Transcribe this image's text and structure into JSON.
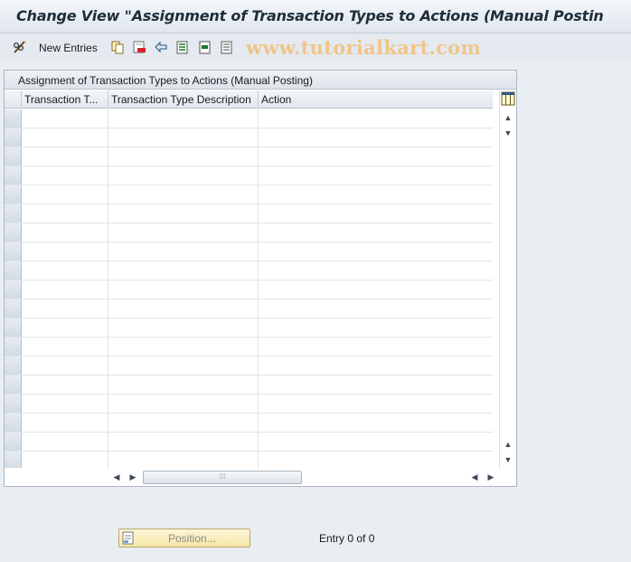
{
  "window": {
    "title": "Change View \"Assignment of Transaction Types to Actions (Manual Postin"
  },
  "toolbar": {
    "new_entries_label": "New Entries",
    "icons": [
      "glasses-pencil-icon",
      "copy-icon",
      "delete-icon",
      "undo-icon",
      "select-all-icon",
      "select-block-icon",
      "deselect-all-icon"
    ]
  },
  "watermark": "www.tutorialkart.com",
  "table": {
    "title": "Assignment of Transaction Types to Actions (Manual Posting)",
    "columns": [
      "Transaction T...",
      "Transaction Type Description",
      "Action"
    ],
    "row_count": 19,
    "rows": []
  },
  "footer": {
    "position_label": "Position...",
    "entry_info": "Entry 0 of 0"
  },
  "colors": {
    "background": "#e9eef3",
    "watermark": "#f0c58a",
    "position_button": "#f4e6a6"
  }
}
